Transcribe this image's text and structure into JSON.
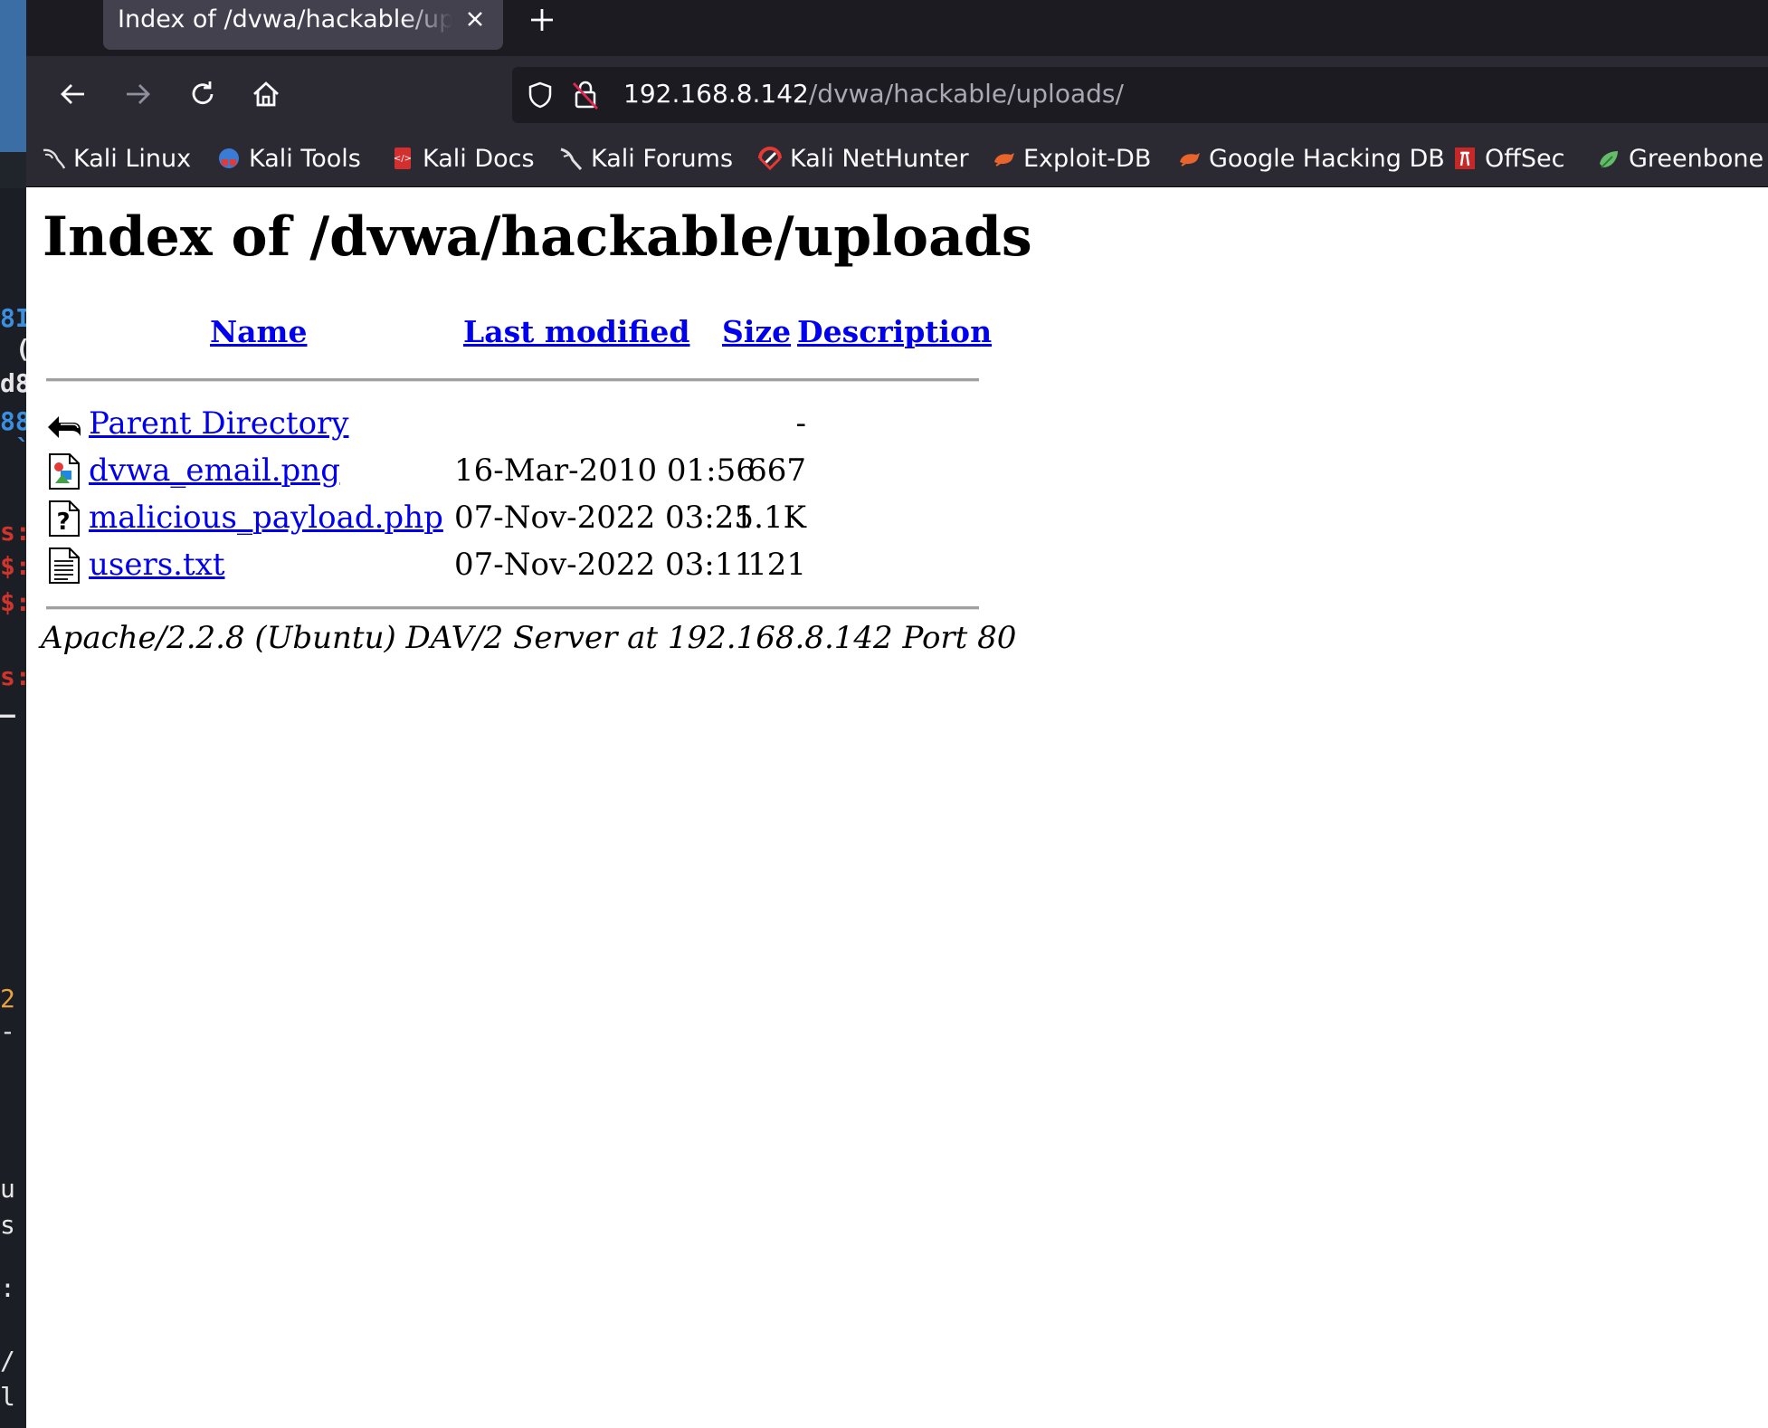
{
  "tab": {
    "title": "Index of /dvwa/hackable/uploads/"
  },
  "url": {
    "host": "192.168.8.142",
    "path": "/dvwa/hackable/uploads/"
  },
  "bookmarks": [
    {
      "label": "Kali Linux",
      "icon": "kali-dragon-icon"
    },
    {
      "label": "Kali Tools",
      "icon": "kali-tools-icon"
    },
    {
      "label": "Kali Docs",
      "icon": "kali-docs-icon"
    },
    {
      "label": "Kali Forums",
      "icon": "kali-forums-icon"
    },
    {
      "label": "Kali NetHunter",
      "icon": "nethunter-icon"
    },
    {
      "label": "Exploit-DB",
      "icon": "exploit-db-icon"
    },
    {
      "label": "Google Hacking DB",
      "icon": "ghdb-icon"
    },
    {
      "label": "OffSec",
      "icon": "offsec-icon"
    },
    {
      "label": "Greenbone",
      "icon": "greenbone-icon"
    }
  ],
  "page": {
    "title": "Index of /dvwa/hackable/uploads",
    "columns": {
      "name": "Name",
      "last_modified": "Last modified",
      "size": "Size",
      "description": "Description"
    },
    "rows": [
      {
        "name": "Parent Directory",
        "modified": "",
        "size": "-",
        "icon": "back-arrow-icon"
      },
      {
        "name": "dvwa_email.png",
        "modified": "16-Mar-2010 01:56",
        "size": "667",
        "icon": "image-file-icon"
      },
      {
        "name": "malicious_payload.php",
        "modified": "07-Nov-2022 03:25",
        "size": "1.1K",
        "icon": "unknown-file-icon"
      },
      {
        "name": "users.txt",
        "modified": "07-Nov-2022 03:11",
        "size": "121",
        "icon": "text-file-icon"
      }
    ],
    "server_signature": "Apache/2.2.8 (Ubuntu) DAV/2 Server at 192.168.8.142 Port 80"
  },
  "colors": {
    "link": "#0000ee",
    "tabbar_bg": "#1c1b22",
    "toolbar_bg": "#2b2a33",
    "active_tab_bg": "#42414d"
  }
}
